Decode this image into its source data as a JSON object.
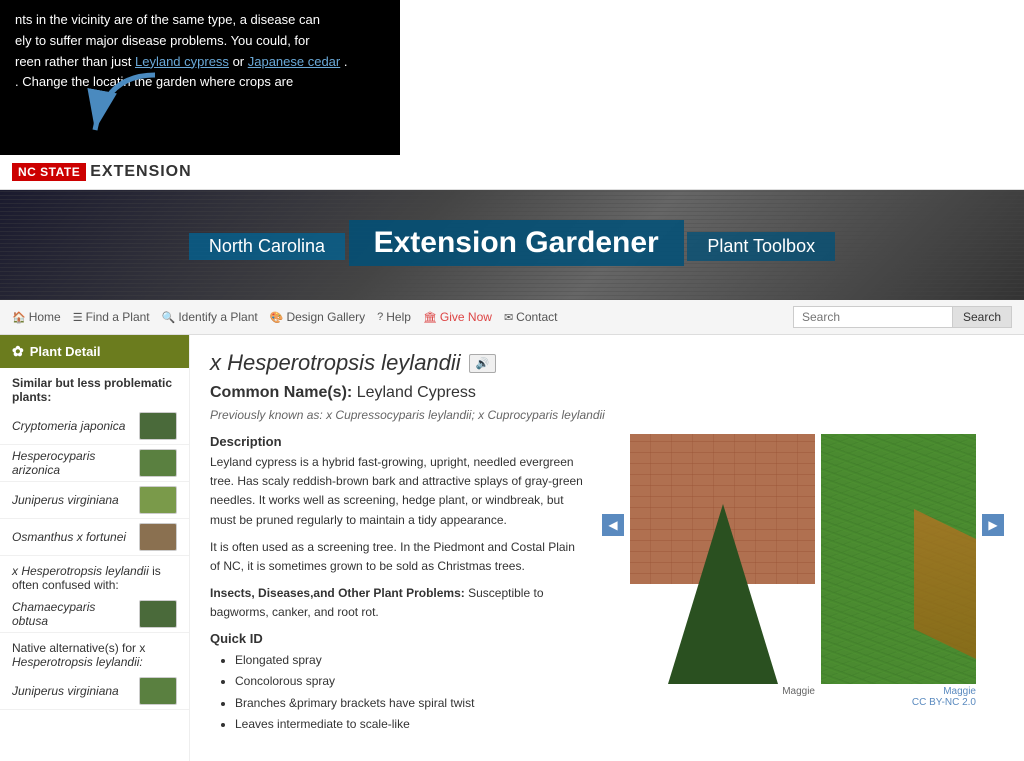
{
  "tooltip": {
    "line1": "nts in the vicinity are of the same type, a disease can",
    "line2": "ely to suffer major disease problems. You could, for",
    "line3": "reen rather than just",
    "link1": "Leyland cypress",
    "mid": " or ",
    "link2": "Japanese cedar",
    "period": ".",
    "line4": ". Change the locati",
    "line4b": "n the garden where crops are"
  },
  "header": {
    "ncstate": "NC STATE",
    "extension": "EXTENSION"
  },
  "banner": {
    "nc_line": "North Carolina",
    "main_line": "Extension Gardener",
    "sub_line": "Plant Toolbox"
  },
  "nav": {
    "home": "Home",
    "find_plant": "Find a Plant",
    "identify_plant": "Identify a Plant",
    "design_gallery": "Design Gallery",
    "help": "Help",
    "give_now": "Give Now",
    "contact": "Contact",
    "search_placeholder": "Search",
    "search_btn": "Search"
  },
  "sidebar": {
    "title": "Plant Detail",
    "similar_title": "Similar but less problematic plants:",
    "similar_plants": [
      {
        "name": "Cryptomeria japonica"
      },
      {
        "name": "Hesperocyparis arizonica"
      },
      {
        "name": "Juniperus virginiana"
      },
      {
        "name": "Osmanthus x fortunei"
      }
    ],
    "confused_intro": "x Hesperotropsis leylandii",
    "confused_label": " is often confused with:",
    "confused_plants": [
      {
        "name": "Chamaecyparis obtusa"
      }
    ],
    "native_intro": "Native alternative(s) for x",
    "native_intro2": "Hesperotropsis leylandii:",
    "native_plants": [
      {
        "name": "Juniperus virginiana"
      }
    ]
  },
  "plant": {
    "title": "x Hesperotropsis leylandii",
    "audio_label": "🔊",
    "common_label": "Common Name(s):",
    "common_name": "Leyland Cypress",
    "previously_label": "Previously known as:",
    "previously_text": "x Cupressocyparis leylandii; x Cuprocyparis leylandii",
    "description_header": "Description",
    "description_p1": "Leyland cypress is a hybrid fast-growing, upright, needled evergreen tree.  Has scaly reddish-brown bark and attractive splays of gray-green needles.  It works well as screening, hedge plant, or windbreak, but must be pruned regularly to maintain a tidy appearance.",
    "description_p2": "It is often used as a screening tree. In the Piedmont and Costal Plain of NC, it is sometimes grown to be sold as Christmas trees.",
    "insects_header": "Insects, Diseases,and Other Plant Problems:",
    "insects_text": "Susceptible to bagworms, canker, and root rot.",
    "quickid_header": "Quick ID",
    "quickid_items": [
      "Elongated spray",
      "Concolorous spray",
      "Branches &primary brackets have spiral twist",
      "Leaves intermediate to scale-like"
    ],
    "image_credit1": "Maggie",
    "image_credit2": "Maggie",
    "image_credit3": "CC BY-NC 2.0"
  }
}
